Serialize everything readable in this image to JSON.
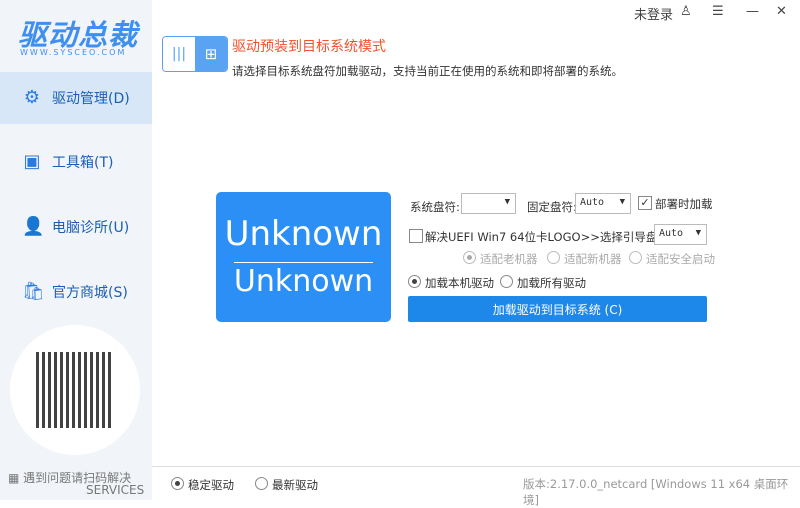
{
  "sidebar": {
    "logo": "驱动总裁",
    "logo_sub": "WWW.SYSCEO.COM",
    "items": [
      {
        "label": "驱动管理(D)",
        "icon": "gear-icon"
      },
      {
        "label": "工具箱(T)",
        "icon": "toolbox-icon"
      },
      {
        "label": "电脑诊所(U)",
        "icon": "user-icon"
      },
      {
        "label": "官方商城(S)",
        "icon": "shopping-bag-icon"
      }
    ],
    "service_text": "遇到问题请扫码解决",
    "service_sub": "SERVICES"
  },
  "topbar": {
    "login": "未登录"
  },
  "header": {
    "title": "驱动预装到目标系统模式",
    "desc": "请选择目标系统盘符加载驱动，支持当前正在使用的系统和即将部署的系统。"
  },
  "card": {
    "line1": "Unknown",
    "line2": "Unknown"
  },
  "form": {
    "system_drive_label": "系统盘符:",
    "system_drive_value": "",
    "fixed_drive_label": "固定盘符:",
    "fixed_drive_value": "Auto",
    "deploy_load_label": "部署时加载",
    "deploy_load_checked": true,
    "uefi_label": "解决UEFI Win7 64位卡LOGO>>选择引导盘符:",
    "uefi_checked": false,
    "boot_drive_value": "Auto",
    "adapt": [
      "适配老机器",
      "适配新机器",
      "适配安全启动"
    ],
    "load_options": [
      "加载本机驱动",
      "加载所有驱动"
    ],
    "submit": "加载驱动到目标系统 (C)"
  },
  "footer": {
    "options": [
      "稳定驱动",
      "最新驱动"
    ],
    "version": "版本:2.17.0.0_netcard [Windows 11 x64 桌面环境]"
  },
  "colors": {
    "accent": "#1e87ea",
    "title": "#f0522d",
    "sidebar_bg": "#f1f4f8"
  }
}
